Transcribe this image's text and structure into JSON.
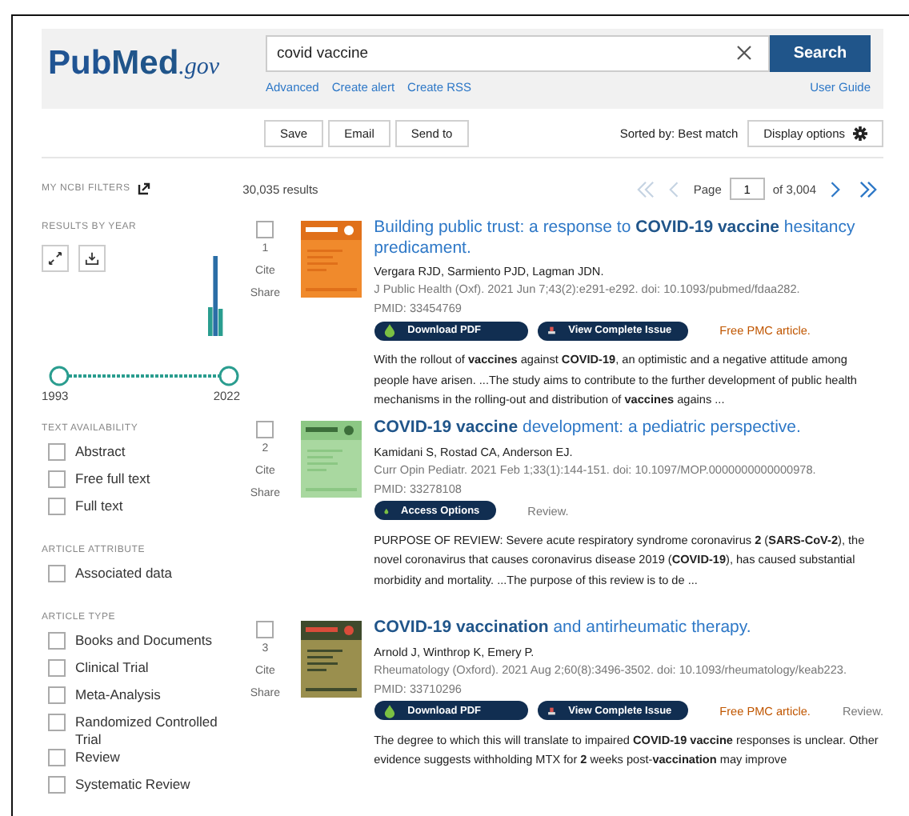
{
  "header": {
    "logo": {
      "main": "Pub",
      "mid": "Med",
      "suffix": ".gov"
    },
    "search": {
      "value": "covid vaccine"
    },
    "search_button": "Search",
    "links": [
      "Advanced",
      "Create alert",
      "Create RSS"
    ],
    "user_guide": "User Guide"
  },
  "toolbar": {
    "buttons": [
      "Save",
      "Email",
      "Send to"
    ],
    "sort": "Sorted by: Best match",
    "display_options": "Display options"
  },
  "sidebar": {
    "my_filters": "MY NCBI FILTERS",
    "results_by_year": {
      "heading": "RESULTS BY YEAR",
      "start_year": "1993",
      "end_year": "2022",
      "handles": [
        {
          "level": 0
        },
        {
          "level": 1
        }
      ]
    },
    "filter_groups": [
      {
        "heading": "TEXT AVAILABILITY",
        "options": [
          {
            "label": "Abstract",
            "checked": false
          },
          {
            "label": "Free full text",
            "checked": false
          },
          {
            "label": "Full text",
            "checked": false
          }
        ]
      },
      {
        "heading": "ARTICLE ATTRIBUTE",
        "options": [
          {
            "label": "Associated data",
            "checked": false
          }
        ]
      },
      {
        "heading": "ARTICLE TYPE",
        "options": [
          {
            "label": "Books and Documents",
            "checked": false
          },
          {
            "label": "Clinical Trial",
            "checked": false
          },
          {
            "label": "Meta-Analysis",
            "checked": false
          },
          {
            "label": "Randomized Controlled Trial",
            "checked": false
          },
          {
            "label": "Review",
            "checked": false
          },
          {
            "label": "Systematic Review",
            "checked": false
          }
        ]
      }
    ]
  },
  "results": {
    "count": "30,035 results",
    "pagination": {
      "page_label": "Page",
      "page": "1",
      "of": "of 3,004"
    },
    "items": [
      {
        "number": "1",
        "checked": false,
        "cite": "Cite",
        "share": "Share",
        "title": "Building public trust: a response to **COVID-19 vaccine** hesitancy predicament.",
        "authors": "Vergara RJD, Sarmiento PJD, Lagman JDN.",
        "citation": "J Public Health (Oxf). 2021 Jun 7;43(2):e291-e292. doi: 10.1093/pubmed/fdaa282.",
        "pmid": "PMID: 33454769",
        "buttons": [
          {
            "label": "Download PDF",
            "kind": "pdf"
          },
          {
            "label": "View Complete Issue",
            "kind": "issue"
          }
        ],
        "free_pmc": "Free PMC article.",
        "snippet": "With the rollout of **vaccines** against **COVID-19**, an optimistic and a negative attitude among people have arisen. ...The study aims to contribute to the further development of public health mechanisms in the rolling-out and distribution of **vaccines** agains ..."
      },
      {
        "number": "2",
        "checked": false,
        "cite": "Cite",
        "share": "Share",
        "title": "**COVID-19 vaccine** development: a pediatric perspective.",
        "authors": "Kamidani S, Rostad CA, Anderson EJ.",
        "citation": "Curr Opin Pediatr. 2021 Feb 1;33(1):144-151. doi: 10.1097/MOP.0000000000000978.",
        "pmid": "PMID: 33278108",
        "buttons": [
          {
            "label": "Access Options",
            "kind": "access"
          }
        ],
        "review": "Review.",
        "snippet": "PURPOSE OF REVIEW: Severe acute respiratory syndrome coronavirus **2** (**SARS-CoV-2**), the novel coronavirus that causes coronavirus disease 2019 (**COVID-19**), has caused substantial morbidity and mortality. ...The purpose of this review is to de ..."
      },
      {
        "number": "3",
        "checked": false,
        "cite": "Cite",
        "share": "Share",
        "title": "**COVID-19 vaccination** and antirheumatic therapy.",
        "authors": "Arnold J, Winthrop K, Emery P.",
        "citation": "Rheumatology (Oxford). 2021 Aug 2;60(8):3496-3502. doi: 10.1093/rheumatology/keab223.",
        "pmid": "PMID: 33710296",
        "buttons": [
          {
            "label": "Download PDF",
            "kind": "pdf"
          },
          {
            "label": "View Complete Issue",
            "kind": "issue"
          }
        ],
        "free_pmc": "Free PMC article.",
        "review": "Review.",
        "snippet": "The degree to which this will translate to impaired **COVID-19 vaccine** responses is unclear. Other evidence suggests withholding MTX for **2** weeks post-**vaccination** may improve"
      }
    ]
  }
}
